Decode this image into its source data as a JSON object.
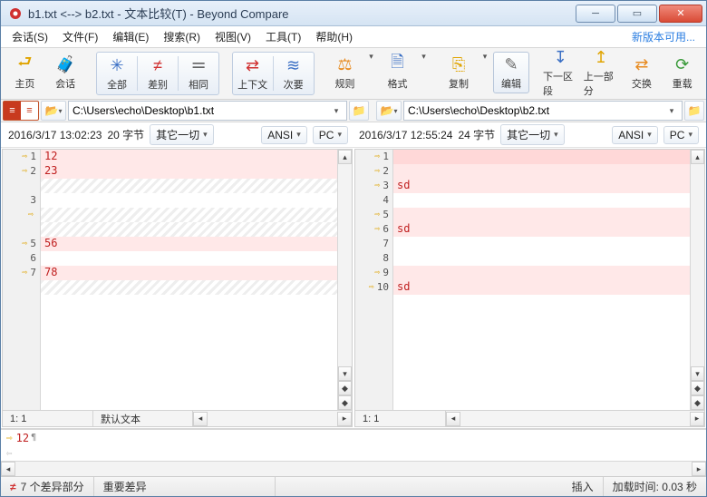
{
  "window": {
    "title": "b1.txt <--> b2.txt - 文本比较(T) - Beyond Compare"
  },
  "menubar": {
    "items": [
      "会话(S)",
      "文件(F)",
      "编辑(E)",
      "搜索(R)",
      "视图(V)",
      "工具(T)",
      "帮助(H)"
    ],
    "new_version": "新版本可用..."
  },
  "toolbar": {
    "home": "主页",
    "session": "会话",
    "all": "全部",
    "diff": "差别",
    "same": "相同",
    "context": "上下文",
    "minor": "次要",
    "rules": "规则",
    "format": "格式",
    "copy": "复制",
    "edit": "编辑",
    "next": "下一区段",
    "prev": "上一部分",
    "swap": "交换",
    "reload": "重载"
  },
  "paths": {
    "left": "C:\\Users\\echo\\Desktop\\b1.txt",
    "right": "C:\\Users\\echo\\Desktop\\b2.txt"
  },
  "info": {
    "left": {
      "time": "2016/3/17 13:02:23",
      "size": "20 字节",
      "filter": "其它一切",
      "enc": "ANSI",
      "plat": "PC"
    },
    "right": {
      "time": "2016/3/17 12:55:24",
      "size": "24 字节",
      "filter": "其它一切",
      "enc": "ANSI",
      "plat": "PC"
    }
  },
  "left_lines": [
    {
      "n": 1,
      "arrow": true,
      "cls": "bg-diff",
      "text": "12"
    },
    {
      "n": 2,
      "arrow": true,
      "cls": "bg-diff",
      "text": "23"
    },
    {
      "n": "",
      "arrow": false,
      "cls": "missing",
      "text": ""
    },
    {
      "n": 3,
      "arrow": false,
      "cls": "",
      "text": ""
    },
    {
      "n": "",
      "arrow": true,
      "cls": "missing",
      "text": ""
    },
    {
      "n": "",
      "arrow": false,
      "cls": "missing",
      "text": ""
    },
    {
      "n": 5,
      "arrow": true,
      "cls": "bg-diff",
      "text": "56"
    },
    {
      "n": 6,
      "arrow": false,
      "cls": "",
      "text": ""
    },
    {
      "n": 7,
      "arrow": true,
      "cls": "bg-diff",
      "text": "78"
    },
    {
      "n": "",
      "arrow": false,
      "cls": "missing",
      "text": ""
    }
  ],
  "right_lines": [
    {
      "n": 1,
      "arrow": true,
      "cls": "bg-diff2",
      "text": ""
    },
    {
      "n": 2,
      "arrow": true,
      "cls": "bg-diff",
      "text": ""
    },
    {
      "n": 3,
      "arrow": true,
      "cls": "bg-diff",
      "text": "sd"
    },
    {
      "n": 4,
      "arrow": false,
      "cls": "",
      "text": ""
    },
    {
      "n": 5,
      "arrow": true,
      "cls": "bg-diff",
      "text": ""
    },
    {
      "n": 6,
      "arrow": true,
      "cls": "bg-diff",
      "text": "sd"
    },
    {
      "n": 7,
      "arrow": false,
      "cls": "",
      "text": ""
    },
    {
      "n": 8,
      "arrow": false,
      "cls": "",
      "text": ""
    },
    {
      "n": 9,
      "arrow": true,
      "cls": "bg-diff",
      "text": ""
    },
    {
      "n": 10,
      "arrow": true,
      "cls": "bg-diff",
      "text": "sd"
    }
  ],
  "footer": {
    "left_pos": "1: 1",
    "left_mode": "默认文本",
    "right_pos": "1: 1"
  },
  "merge": {
    "text": "12"
  },
  "status": {
    "diff_count": "7 个差异部分",
    "important": "重要差异",
    "insert": "插入",
    "loadtime": "加载时间: 0.03 秒"
  }
}
